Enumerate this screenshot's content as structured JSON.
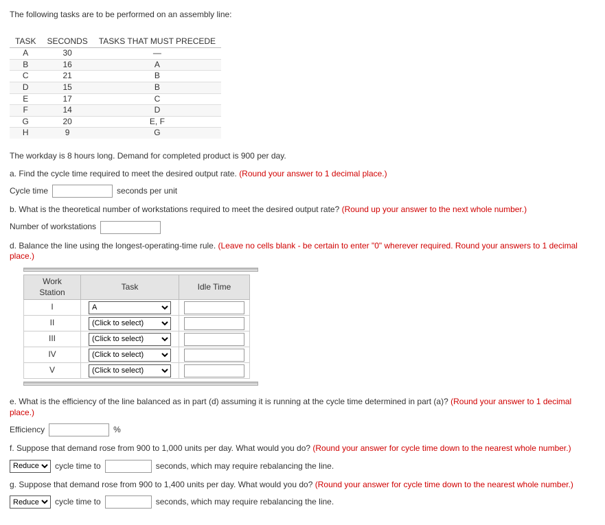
{
  "intro": "The following tasks are to be performed on an assembly line:",
  "table_headers": {
    "task": "TASK",
    "seconds": "SECONDS",
    "precede": "TASKS THAT MUST PRECEDE"
  },
  "tasks": [
    {
      "t": "A",
      "s": "30",
      "p": "—"
    },
    {
      "t": "B",
      "s": "16",
      "p": "A"
    },
    {
      "t": "C",
      "s": "21",
      "p": "B"
    },
    {
      "t": "D",
      "s": "15",
      "p": "B"
    },
    {
      "t": "E",
      "s": "17",
      "p": "C"
    },
    {
      "t": "F",
      "s": "14",
      "p": "D"
    },
    {
      "t": "G",
      "s": "20",
      "p": "E, F"
    },
    {
      "t": "H",
      "s": "9",
      "p": "G"
    }
  ],
  "workday": "The workday is 8 hours long. Demand for completed product is 900 per day.",
  "a": {
    "prompt": "a. Find the cycle time required to meet the desired output rate. ",
    "hint": "(Round your answer to 1 decimal place.)",
    "label": "Cycle time",
    "unit": "seconds per unit"
  },
  "b": {
    "prompt": "b. What is the theoretical number of workstations required to meet the desired output rate? ",
    "hint": "(Round up your answer to the next whole number.)",
    "label": "Number of workstations"
  },
  "d": {
    "prompt": "d. Balance the line using the longest-operating-time rule. ",
    "hint": "(Leave no cells blank - be certain to enter \"0\" wherever required. Round your answers to 1 decimal place.)",
    "headers": {
      "ws": "Work Station",
      "task": "Task",
      "idle": "Idle Time"
    },
    "rows": [
      {
        "ws": "I",
        "task_sel": "A"
      },
      {
        "ws": "II",
        "task_sel": "(Click to select)"
      },
      {
        "ws": "III",
        "task_sel": "(Click to select)"
      },
      {
        "ws": "IV",
        "task_sel": "(Click to select)"
      },
      {
        "ws": "V",
        "task_sel": "(Click to select)"
      }
    ]
  },
  "e": {
    "prompt": "e. What is the efficiency of the line balanced as in part (d) assuming it is running at the cycle time determined in part (a)? ",
    "hint": "(Round your answer to 1 decimal place.)",
    "label": "Efficiency",
    "unit": "%"
  },
  "f": {
    "prompt": "f. Suppose that demand rose from 900 to 1,000 units per day. What would you do? ",
    "hint": "(Round your answer for cycle time down to the nearest whole number.)",
    "action": "Reduce",
    "mid": "cycle time to",
    "tail": "seconds, which may require rebalancing the line."
  },
  "g": {
    "prompt": "g. Suppose that demand rose from 900 to 1,400 units per day. What would you do? ",
    "hint": "(Round your answer for cycle time down to the nearest whole number.)",
    "action": "Reduce",
    "mid": "cycle time to",
    "tail": "seconds, which may require rebalancing the line."
  }
}
